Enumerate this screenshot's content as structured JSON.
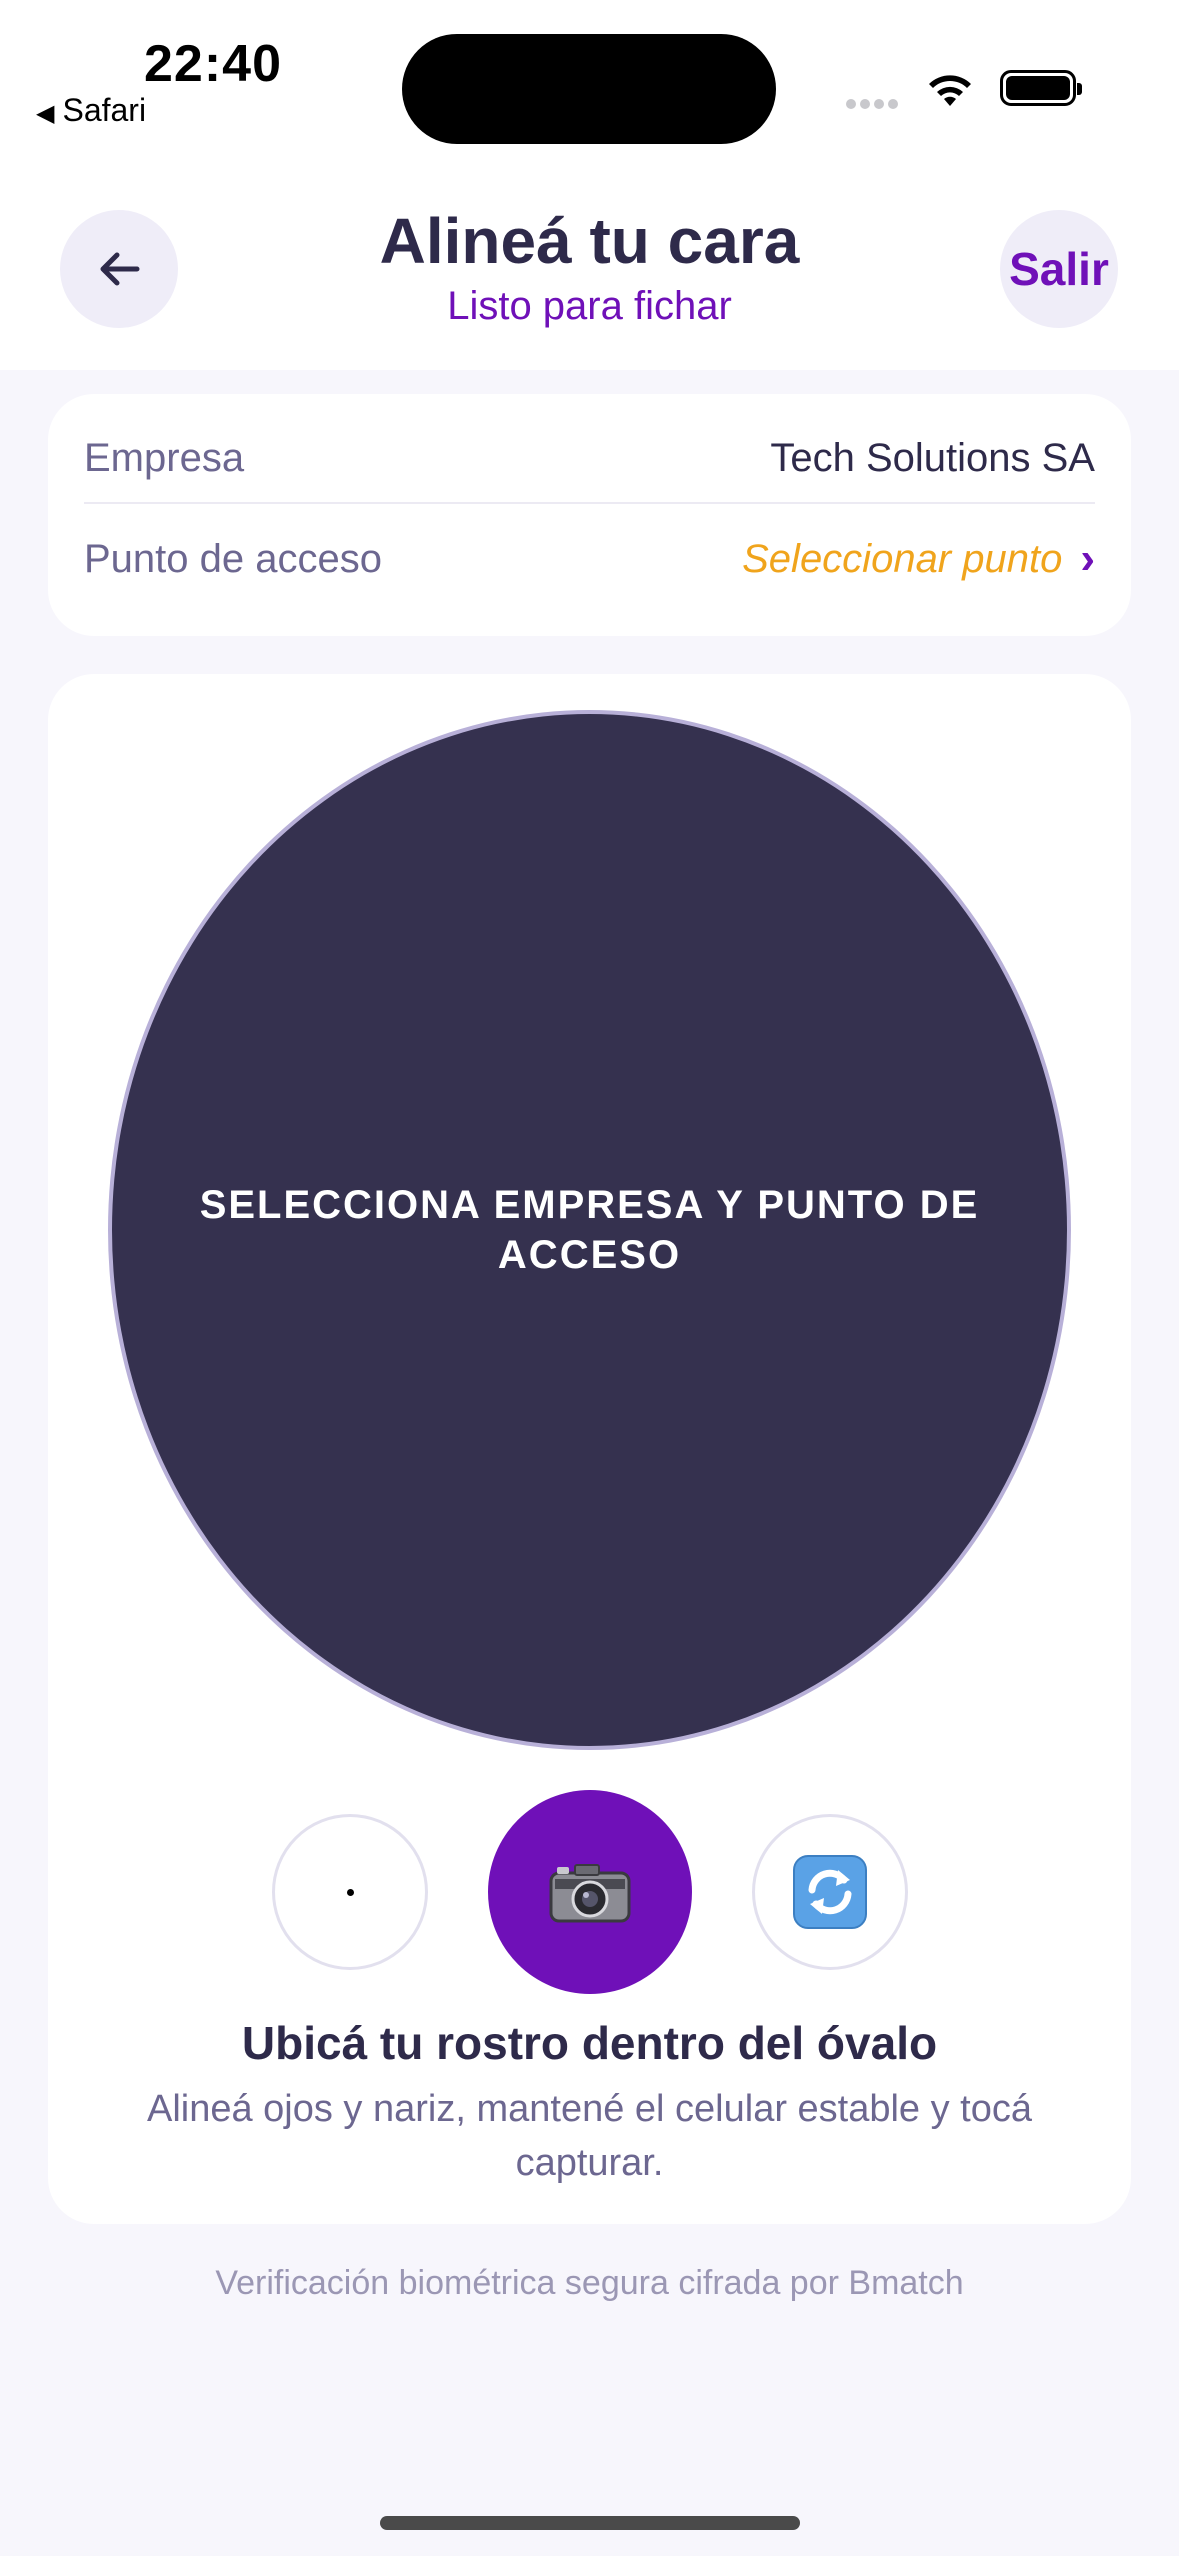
{
  "status_bar": {
    "time": "22:40",
    "back_app": "Safari",
    "icons": [
      "signal-dots-icon",
      "wifi-icon",
      "battery-icon"
    ]
  },
  "header": {
    "title": "Alineá tu cara",
    "subtitle": "Listo para fichar",
    "back_icon": "arrow-left-icon",
    "exit_label": "Salir"
  },
  "info": {
    "company_label": "Empresa",
    "company_value": "Tech Solutions SA",
    "access_label": "Punto de acceso",
    "access_value": "Seleccionar punto",
    "access_chevron": "›"
  },
  "capture": {
    "oval_message": "SELECCIONA EMPRESA Y PUNTO DE ACCESO",
    "left_control_icon": "dot-icon",
    "shutter_icon": "camera-icon",
    "right_control_icon": "switch-camera-icon",
    "hint_title": "Ubicá tu rostro dentro del óvalo",
    "hint_body": "Alineá ojos y nariz, mantené el celular estable y tocá capturar."
  },
  "footer": {
    "note": "Verificación biométrica segura cifrada por Bmatch"
  },
  "colors": {
    "accent": "#6f10b8",
    "warning": "#f0a41c",
    "oval_bg": "#35314f",
    "page_bg": "#f7f6fc"
  }
}
